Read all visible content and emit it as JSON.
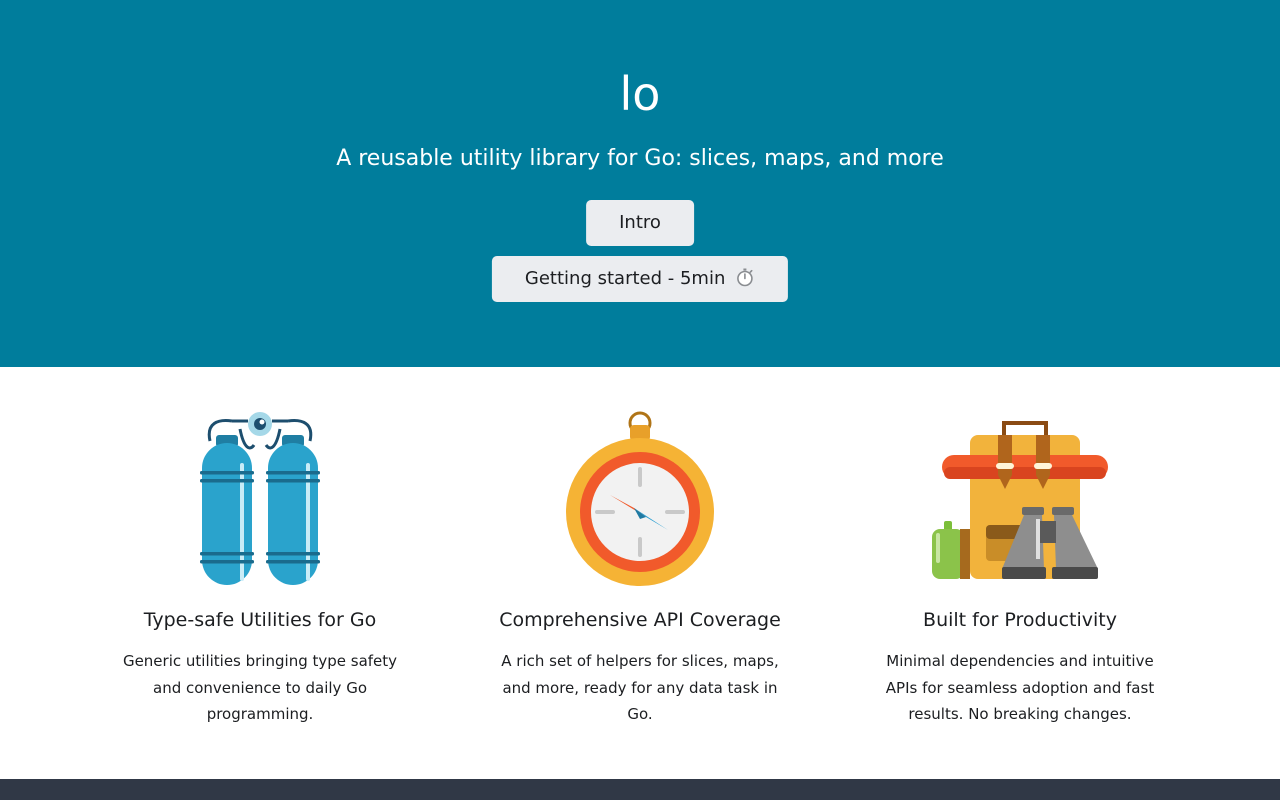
{
  "hero": {
    "title": "lo",
    "subtitle": "A reusable utility library for Go: slices, maps, and more",
    "intro_button": "Intro",
    "getting_started_button": "Getting started - 5min",
    "getting_started_icon": "stopwatch-icon",
    "background_color": "#007d9c"
  },
  "features": [
    {
      "icon": "oxygen-tanks-icon",
      "title": "Type-safe Utilities for Go",
      "description": "Generic utilities bringing type safety and convenience to daily Go programming."
    },
    {
      "icon": "compass-icon",
      "title": "Comprehensive API Coverage",
      "description": "A rich set of helpers for slices, maps, and more, ready for any data task in Go."
    },
    {
      "icon": "backpack-binoculars-icon",
      "title": "Built for Productivity",
      "description": "Minimal dependencies and intuitive APIs for seamless adoption and fast results. No breaking changes."
    }
  ],
  "footer": {
    "background_color": "#303846"
  }
}
